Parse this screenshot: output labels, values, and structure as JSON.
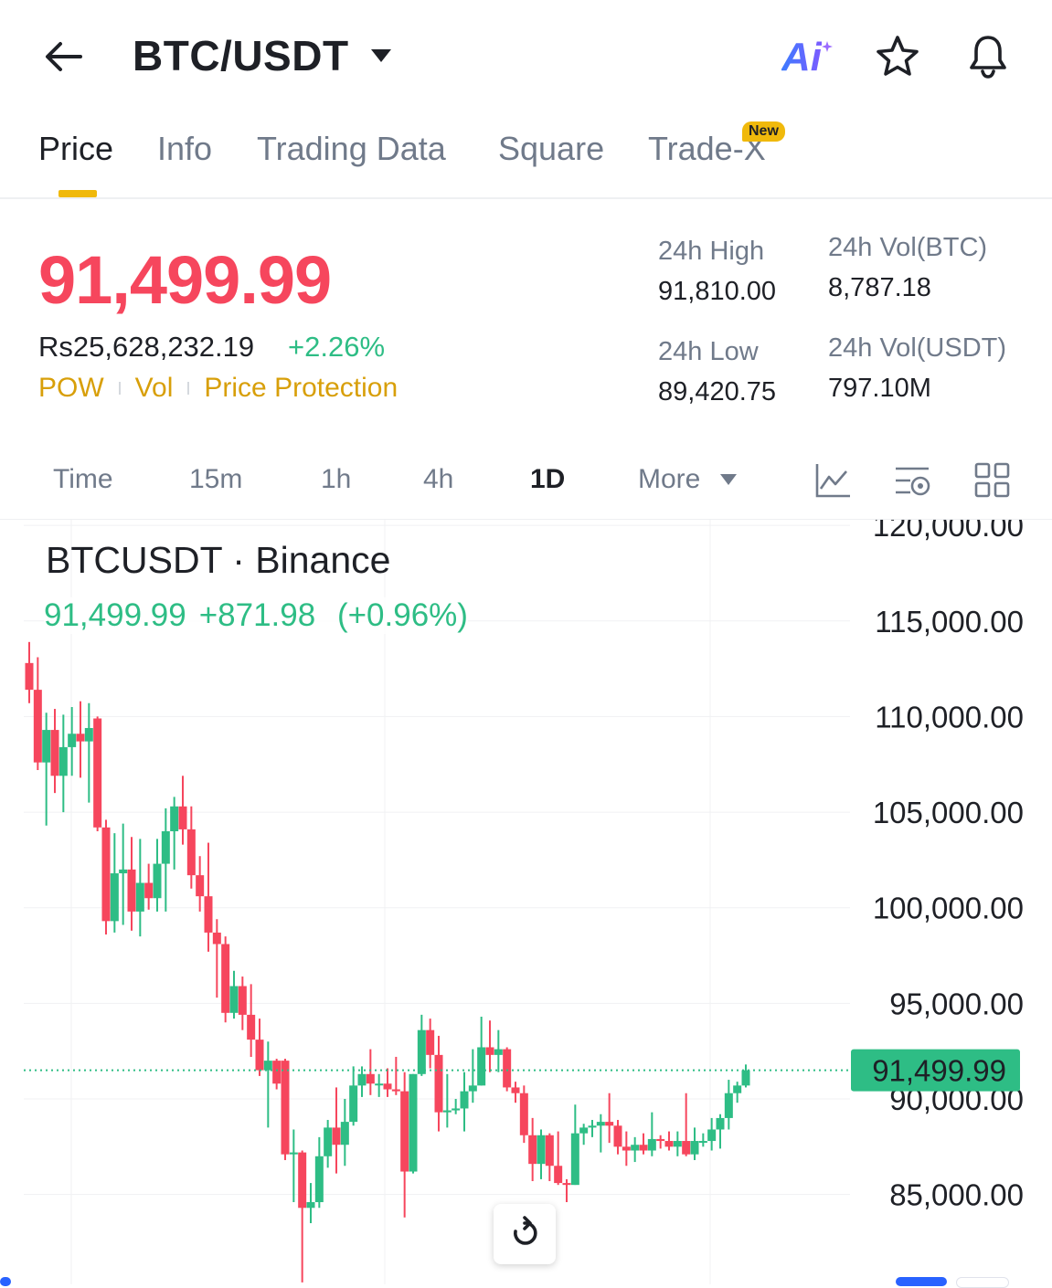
{
  "header": {
    "pair": "BTC/USDT",
    "ai_label": "Ai"
  },
  "tabs": [
    {
      "label": "Price",
      "active": true
    },
    {
      "label": "Info"
    },
    {
      "label": "Trading Data"
    },
    {
      "label": "Square"
    },
    {
      "label": "Trade-X",
      "badge": "New"
    }
  ],
  "price": {
    "last": "91,499.99",
    "fiat": "Rs25,628,232.19",
    "change_pct": "+2.26%",
    "tags": [
      "POW",
      "Vol",
      "Price Protection"
    ]
  },
  "stats": {
    "high_label": "24h High",
    "high": "91,810.00",
    "low_label": "24h Low",
    "low": "89,420.75",
    "vol_btc_label": "24h Vol(BTC)",
    "vol_btc": "8,787.18",
    "vol_usdt_label": "24h Vol(USDT)",
    "vol_usdt": "797.10M"
  },
  "intervals": [
    "Time",
    "15m",
    "1h",
    "4h",
    "1D",
    "More"
  ],
  "active_interval": "1D",
  "colors": {
    "up": "#2ebd85",
    "down": "#f6465d",
    "accent": "#f0b90b",
    "muted": "#707a8a"
  },
  "chart_data": {
    "type": "candlestick",
    "title": "BTCUSDT · Binance",
    "last_price": "91,499.99",
    "change": "+871.98",
    "change_pct": "(+0.96%)",
    "price_tag": "91,499.99",
    "y_ticks": [
      "120,000.00",
      "115,000.00",
      "110,000.00",
      "105,000.00",
      "100,000.00",
      "95,000.00",
      "90,000.00",
      "85,000.00"
    ],
    "y_tick_values": [
      120000,
      115000,
      110000,
      105000,
      100000,
      95000,
      90000,
      85000
    ],
    "ylim": [
      80300,
      120150
    ],
    "grid": true,
    "candles": [
      {
        "o": 112800,
        "h": 113900,
        "l": 110700,
        "c": 111400
      },
      {
        "o": 111400,
        "h": 113100,
        "l": 107200,
        "c": 107600
      },
      {
        "o": 107600,
        "h": 110200,
        "l": 104300,
        "c": 109300
      },
      {
        "o": 109300,
        "h": 110400,
        "l": 106000,
        "c": 106900
      },
      {
        "o": 106900,
        "h": 110100,
        "l": 105000,
        "c": 108400
      },
      {
        "o": 108400,
        "h": 110500,
        "l": 106900,
        "c": 109100
      },
      {
        "o": 109100,
        "h": 110800,
        "l": 106800,
        "c": 108700
      },
      {
        "o": 108700,
        "h": 110700,
        "l": 105500,
        "c": 109400
      },
      {
        "o": 109900,
        "h": 110000,
        "l": 104000,
        "c": 104200
      },
      {
        "o": 104200,
        "h": 104600,
        "l": 98600,
        "c": 99300
      },
      {
        "o": 99300,
        "h": 103900,
        "l": 98700,
        "c": 101800
      },
      {
        "o": 101800,
        "h": 104400,
        "l": 99100,
        "c": 102000
      },
      {
        "o": 102000,
        "h": 103700,
        "l": 98800,
        "c": 99800
      },
      {
        "o": 99800,
        "h": 103600,
        "l": 98500,
        "c": 101300
      },
      {
        "o": 101300,
        "h": 102300,
        "l": 99900,
        "c": 100500
      },
      {
        "o": 100500,
        "h": 103600,
        "l": 99800,
        "c": 102300
      },
      {
        "o": 102300,
        "h": 105200,
        "l": 99800,
        "c": 104000
      },
      {
        "o": 104000,
        "h": 105800,
        "l": 102000,
        "c": 105300
      },
      {
        "o": 105300,
        "h": 106900,
        "l": 103300,
        "c": 104100
      },
      {
        "o": 104100,
        "h": 105300,
        "l": 101000,
        "c": 101700
      },
      {
        "o": 101700,
        "h": 102700,
        "l": 99800,
        "c": 100600
      },
      {
        "o": 100600,
        "h": 103400,
        "l": 97700,
        "c": 98700
      },
      {
        "o": 98700,
        "h": 99400,
        "l": 95300,
        "c": 98100
      },
      {
        "o": 98100,
        "h": 98500,
        "l": 94000,
        "c": 94500
      },
      {
        "o": 94500,
        "h": 96700,
        "l": 94200,
        "c": 95900
      },
      {
        "o": 95900,
        "h": 96400,
        "l": 93600,
        "c": 94400
      },
      {
        "o": 94400,
        "h": 96000,
        "l": 92200,
        "c": 93100
      },
      {
        "o": 93100,
        "h": 94200,
        "l": 91200,
        "c": 91500
      },
      {
        "o": 91500,
        "h": 93000,
        "l": 88500,
        "c": 92000
      },
      {
        "o": 92000,
        "h": 92100,
        "l": 90500,
        "c": 90800
      },
      {
        "o": 92000,
        "h": 92100,
        "l": 86800,
        "c": 87100
      },
      {
        "o": 87100,
        "h": 88400,
        "l": 84600,
        "c": 87200
      },
      {
        "o": 87200,
        "h": 87300,
        "l": 80400,
        "c": 84300
      },
      {
        "o": 84300,
        "h": 85600,
        "l": 83500,
        "c": 84600
      },
      {
        "o": 84600,
        "h": 88000,
        "l": 84300,
        "c": 87000
      },
      {
        "o": 87000,
        "h": 88900,
        "l": 86400,
        "c": 88500
      },
      {
        "o": 88500,
        "h": 90600,
        "l": 86100,
        "c": 87600
      },
      {
        "o": 87600,
        "h": 90000,
        "l": 86500,
        "c": 88800
      },
      {
        "o": 88800,
        "h": 91700,
        "l": 88600,
        "c": 90700
      },
      {
        "o": 90700,
        "h": 91700,
        "l": 90100,
        "c": 91300
      },
      {
        "o": 91300,
        "h": 92600,
        "l": 90200,
        "c": 90800
      },
      {
        "o": 90800,
        "h": 91300,
        "l": 90100,
        "c": 90800
      },
      {
        "o": 90800,
        "h": 91600,
        "l": 90100,
        "c": 90500
      },
      {
        "o": 90500,
        "h": 92200,
        "l": 90200,
        "c": 90400
      },
      {
        "o": 90400,
        "h": 91400,
        "l": 83800,
        "c": 86200
      },
      {
        "o": 86200,
        "h": 91300,
        "l": 86100,
        "c": 91300
      },
      {
        "o": 91300,
        "h": 94400,
        "l": 91200,
        "c": 93600
      },
      {
        "o": 93600,
        "h": 94200,
        "l": 91600,
        "c": 92300
      },
      {
        "o": 92300,
        "h": 93300,
        "l": 88300,
        "c": 89300
      },
      {
        "o": 89300,
        "h": 91300,
        "l": 88500,
        "c": 89400
      },
      {
        "o": 89400,
        "h": 90000,
        "l": 89200,
        "c": 89500
      },
      {
        "o": 89500,
        "h": 91400,
        "l": 88300,
        "c": 90400
      },
      {
        "o": 90400,
        "h": 92600,
        "l": 89800,
        "c": 90700
      },
      {
        "o": 90700,
        "h": 94300,
        "l": 90700,
        "c": 92700
      },
      {
        "o": 92700,
        "h": 94100,
        "l": 91400,
        "c": 92300
      },
      {
        "o": 92300,
        "h": 93600,
        "l": 91400,
        "c": 92600
      },
      {
        "o": 92600,
        "h": 92700,
        "l": 90400,
        "c": 90600
      },
      {
        "o": 90600,
        "h": 90900,
        "l": 89800,
        "c": 90300
      },
      {
        "o": 90300,
        "h": 90700,
        "l": 87700,
        "c": 88100
      },
      {
        "o": 88100,
        "h": 89000,
        "l": 85700,
        "c": 86600
      },
      {
        "o": 86600,
        "h": 88400,
        "l": 85800,
        "c": 88100
      },
      {
        "o": 88100,
        "h": 88200,
        "l": 85700,
        "c": 86500
      },
      {
        "o": 86500,
        "h": 88300,
        "l": 85500,
        "c": 85600
      },
      {
        "o": 85600,
        "h": 85800,
        "l": 84600,
        "c": 85500
      },
      {
        "o": 85500,
        "h": 89700,
        "l": 85500,
        "c": 88200
      },
      {
        "o": 88200,
        "h": 88700,
        "l": 87600,
        "c": 88500
      },
      {
        "o": 88500,
        "h": 88900,
        "l": 88000,
        "c": 88600
      },
      {
        "o": 88600,
        "h": 89200,
        "l": 87200,
        "c": 88800
      },
      {
        "o": 88800,
        "h": 90300,
        "l": 87700,
        "c": 88600
      },
      {
        "o": 88600,
        "h": 88900,
        "l": 87100,
        "c": 87500
      },
      {
        "o": 87500,
        "h": 88300,
        "l": 86500,
        "c": 87300
      },
      {
        "o": 87300,
        "h": 88000,
        "l": 86700,
        "c": 87600
      },
      {
        "o": 87600,
        "h": 88200,
        "l": 87100,
        "c": 87300
      },
      {
        "o": 87300,
        "h": 89300,
        "l": 87000,
        "c": 87900
      },
      {
        "o": 87900,
        "h": 88100,
        "l": 87400,
        "c": 87800
      },
      {
        "o": 87800,
        "h": 88300,
        "l": 87300,
        "c": 87500
      },
      {
        "o": 87500,
        "h": 88300,
        "l": 87000,
        "c": 87800
      },
      {
        "o": 87800,
        "h": 90300,
        "l": 87000,
        "c": 87100
      },
      {
        "o": 87100,
        "h": 88500,
        "l": 86800,
        "c": 87800
      },
      {
        "o": 87800,
        "h": 88200,
        "l": 87500,
        "c": 87800
      },
      {
        "o": 87800,
        "h": 89000,
        "l": 87300,
        "c": 88400
      },
      {
        "o": 88400,
        "h": 89200,
        "l": 87400,
        "c": 89000
      },
      {
        "o": 89000,
        "h": 91000,
        "l": 88400,
        "c": 90300
      },
      {
        "o": 90300,
        "h": 90900,
        "l": 89800,
        "c": 90700
      },
      {
        "o": 90700,
        "h": 91800,
        "l": 90600,
        "c": 91500
      }
    ]
  }
}
